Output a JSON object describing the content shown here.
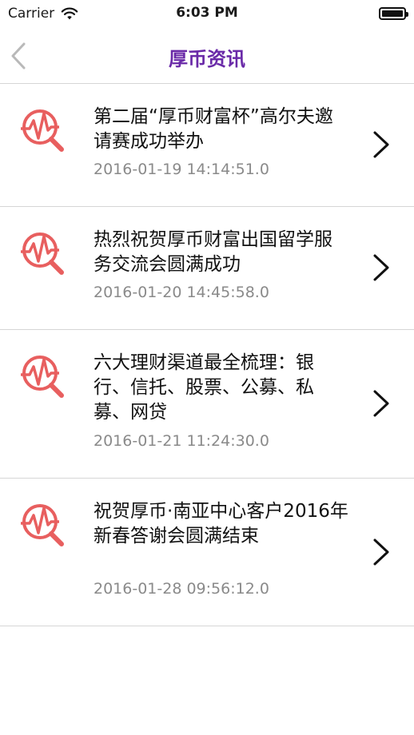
{
  "status_bar": {
    "carrier": "Carrier",
    "time": "6:03 PM"
  },
  "nav": {
    "title": "厚币资讯",
    "back_icon": "chevron-left-icon"
  },
  "colors": {
    "title": "#6a2aa8",
    "icon": "#e85f5f",
    "date": "#8a8a8a",
    "divider": "#d6d6d6"
  },
  "news": [
    {
      "title": "第二届“厚币财富杯”高尔夫邀请赛成功举办",
      "date": "2016-01-19 14:14:51.0"
    },
    {
      "title": "热烈祝贺厚币财富出国留学服务交流会圆满成功",
      "date": "2016-01-20 14:45:58.0"
    },
    {
      "title": "六大理财渠道最全梳理：银行、信托、股票、公募、私募、网贷",
      "date": "2016-01-21 11:24:30.0"
    },
    {
      "title": "祝贺厚币·南亚中心客户2016年新春答谢会圆满结束",
      "date": "2016-01-28 09:56:12.0"
    }
  ]
}
